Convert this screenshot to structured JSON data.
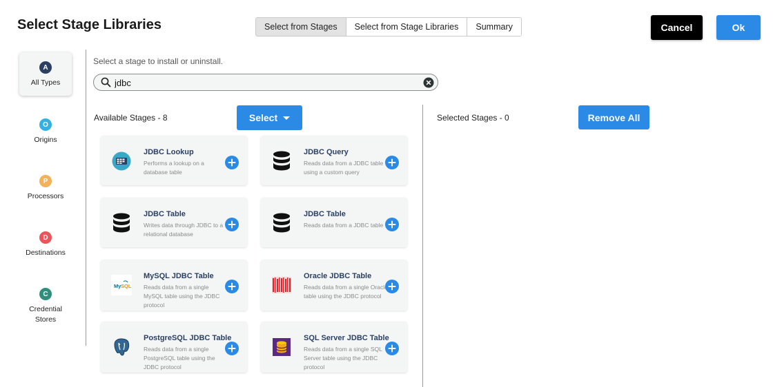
{
  "dialog": {
    "title": "Select Stage Libraries"
  },
  "tabs": [
    {
      "label": "Select from Stages",
      "active": true
    },
    {
      "label": "Select from Stage Libraries",
      "active": false
    },
    {
      "label": "Summary",
      "active": false
    }
  ],
  "actions": {
    "cancel_label": "Cancel",
    "ok_label": "Ok"
  },
  "nav": [
    {
      "badge": "A",
      "label": "All Types",
      "color": "#2b3f63",
      "active": true
    },
    {
      "badge": "O",
      "label": "Origins",
      "color": "#36b0e0",
      "active": false
    },
    {
      "badge": "P",
      "label": "Processors",
      "color": "#f3b15a",
      "active": false
    },
    {
      "badge": "D",
      "label": "Destinations",
      "color": "#e8555a",
      "active": false
    },
    {
      "badge": "C",
      "label": "Credential Stores",
      "color": "#2f8f7a",
      "active": false
    }
  ],
  "hint": "Select a stage to install or uninstall.",
  "search": {
    "value": "jdbc",
    "icon": "search-icon",
    "clear_icon": "clear-icon"
  },
  "available": {
    "label": "Available Stages - 8",
    "select_label": "Select"
  },
  "selected": {
    "label": "Selected Stages - 0",
    "remove_all_label": "Remove All"
  },
  "stages": [
    {
      "title": "JDBC Lookup",
      "desc": "Performs a lookup on a database table",
      "icon": "jdbc-lookup-icon"
    },
    {
      "title": "JDBC Query",
      "desc": "Reads data from a JDBC table using a custom query",
      "icon": "database-icon"
    },
    {
      "title": "JDBC Table",
      "desc": "Writes data through JDBC to a relational database",
      "icon": "database-icon"
    },
    {
      "title": "JDBC Table",
      "desc": "Reads data from a JDBC table",
      "icon": "database-icon"
    },
    {
      "title": "MySQL JDBC Table",
      "desc": "Reads data from a single MySQL table using the JDBC protocol",
      "icon": "mysql-logo-icon"
    },
    {
      "title": "Oracle JDBC Table",
      "desc": "Reads data from a single Oracle table using the JDBC protocol",
      "icon": "oracle-logo-icon"
    },
    {
      "title": "PostgreSQL JDBC Table",
      "desc": "Reads data from a single PostgreSQL table using the JDBC protocol",
      "icon": "postgresql-logo-icon"
    },
    {
      "title": "SQL Server JDBC Table",
      "desc": "Reads data from a single SQL Server table using the JDBC protocol",
      "icon": "sqlserver-logo-icon"
    }
  ],
  "colors": {
    "accent": "#2a8ae6",
    "title_text": "#2b3f63",
    "card_bg": "#f4f6f5"
  }
}
